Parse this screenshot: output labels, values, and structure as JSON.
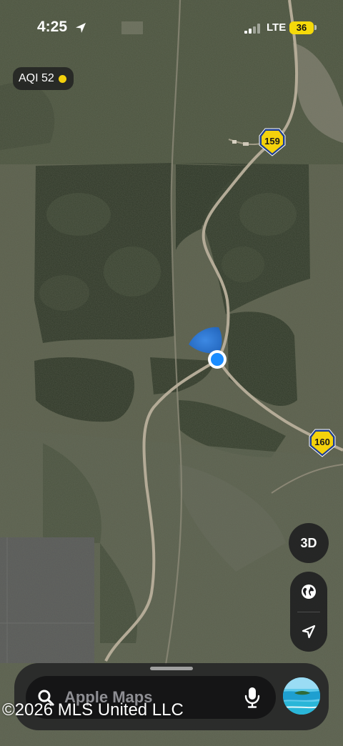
{
  "status_bar": {
    "time": "4:25",
    "network": "LTE",
    "battery": "36"
  },
  "aqi": {
    "label": "AQI 52",
    "level_color": "#f4d20c"
  },
  "routes": [
    {
      "label": "159",
      "color": "#f4d20c"
    },
    {
      "label": "160",
      "color": "#f4d20c"
    }
  ],
  "controls": {
    "view_3d": "3D",
    "map_mode_icon": "globe-icon",
    "locate_icon": "location-arrow-icon"
  },
  "search": {
    "placeholder": "Apple Maps",
    "icons": [
      "search-icon",
      "microphone-icon"
    ],
    "thumbnail": "beach-thumbnail"
  },
  "watermark": "©2026 MLS United LLC",
  "colors": {
    "forest_dark": "#3f4735",
    "clearing": "#6d6c5c",
    "road": "#a79f8e",
    "pond": "#2c7de6",
    "user_location": "#1a8cff"
  }
}
